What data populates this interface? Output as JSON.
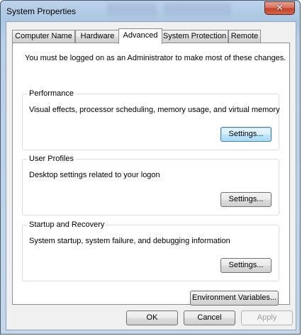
{
  "window": {
    "title": "System Properties",
    "close_glyph": "✕"
  },
  "tabs": [
    {
      "label": "Computer Name"
    },
    {
      "label": "Hardware"
    },
    {
      "label": "Advanced"
    },
    {
      "label": "System Protection"
    },
    {
      "label": "Remote"
    }
  ],
  "active_tab": "Advanced",
  "advanced": {
    "admin_note": "You must be logged on as an Administrator to make most of these changes.",
    "performance": {
      "title": "Performance",
      "description": "Visual effects, processor scheduling, memory usage, and virtual memory",
      "button": "Settings..."
    },
    "user_profiles": {
      "title": "User Profiles",
      "description": "Desktop settings related to your logon",
      "button": "Settings..."
    },
    "startup_recovery": {
      "title": "Startup and Recovery",
      "description": "System startup, system failure, and debugging information",
      "button": "Settings..."
    },
    "env_button": "Environment Variables..."
  },
  "footer": {
    "ok": "OK",
    "cancel": "Cancel",
    "apply": "Apply"
  },
  "colors": {
    "titlebar": "#aac6e2",
    "close_button": "#c2432a",
    "focus_border": "#3c7fb1"
  }
}
